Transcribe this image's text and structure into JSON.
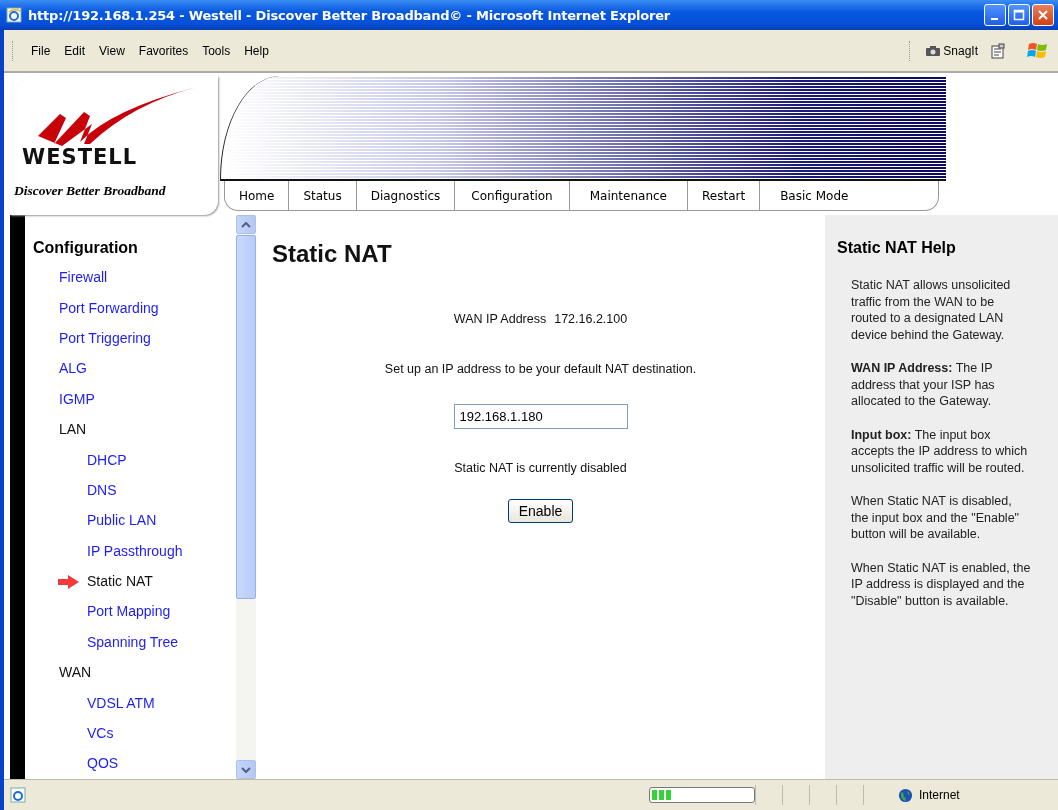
{
  "window": {
    "title": "http://192.168.1.254 - Westell - Discover Better Broadband© - Microsoft Internet Explorer"
  },
  "menu": [
    "File",
    "Edit",
    "View",
    "Favorites",
    "Tools",
    "Help"
  ],
  "toolbar": {
    "snagit": "SnagIt"
  },
  "header": {
    "logo": "WESTELL",
    "tagline": "Discover Better Broadband",
    "tabs": [
      "Home",
      "Status",
      "Diagnostics",
      "Configuration",
      "Maintenance",
      "Restart",
      "Basic Mode"
    ]
  },
  "sidebar": {
    "title": "Configuration",
    "items": [
      {
        "label": "Firewall",
        "kind": "link",
        "selected": false
      },
      {
        "label": "Port Forwarding",
        "kind": "link",
        "selected": false
      },
      {
        "label": "Port Triggering",
        "kind": "link",
        "selected": false
      },
      {
        "label": "ALG",
        "kind": "link",
        "selected": false
      },
      {
        "label": "IGMP",
        "kind": "link",
        "selected": false
      },
      {
        "label": "LAN",
        "kind": "group",
        "selected": false,
        "children": [
          {
            "label": "DHCP",
            "kind": "link",
            "selected": false
          },
          {
            "label": "DNS",
            "kind": "link",
            "selected": false
          },
          {
            "label": "Public LAN",
            "kind": "link",
            "selected": false
          },
          {
            "label": "IP Passthrough",
            "kind": "link",
            "selected": false
          },
          {
            "label": "Static NAT",
            "kind": "link",
            "selected": true
          },
          {
            "label": "Port Mapping",
            "kind": "link",
            "selected": false
          },
          {
            "label": "Spanning Tree",
            "kind": "link",
            "selected": false
          }
        ]
      },
      {
        "label": "WAN",
        "kind": "group",
        "selected": false,
        "children": [
          {
            "label": "VDSL ATM",
            "kind": "link",
            "selected": false
          },
          {
            "label": "VCs",
            "kind": "link",
            "selected": false
          },
          {
            "label": "QOS",
            "kind": "link",
            "selected": false
          }
        ]
      }
    ]
  },
  "main": {
    "title": "Static NAT",
    "wan_label": "WAN IP Address",
    "wan_value": "172.16.2.100",
    "instruction": "Set up an IP address to be your default NAT destination.",
    "ip_field": {
      "value": "192.168.1.180"
    },
    "status": "Static NAT is currently disabled",
    "button": "Enable"
  },
  "help": {
    "title": "Static NAT Help",
    "paragraphs": [
      "Static NAT allows unsolicited traffic from the WAN to be routed to a designated LAN device behind the Gateway.",
      "**WAN IP Address:** The IP address that your ISP has allocated to the Gateway.",
      "**Input box:** The input box accepts the IP address to which unsolicited traffic will be routed.",
      "When Static NAT is disabled, the input box and the \"Enable\" button will be available.",
      "When Static NAT is enabled, the IP address is displayed and the \"Disable\" button is available."
    ]
  },
  "status_bar": {
    "zone": "Internet",
    "progress": {
      "level": 0.2
    }
  }
}
